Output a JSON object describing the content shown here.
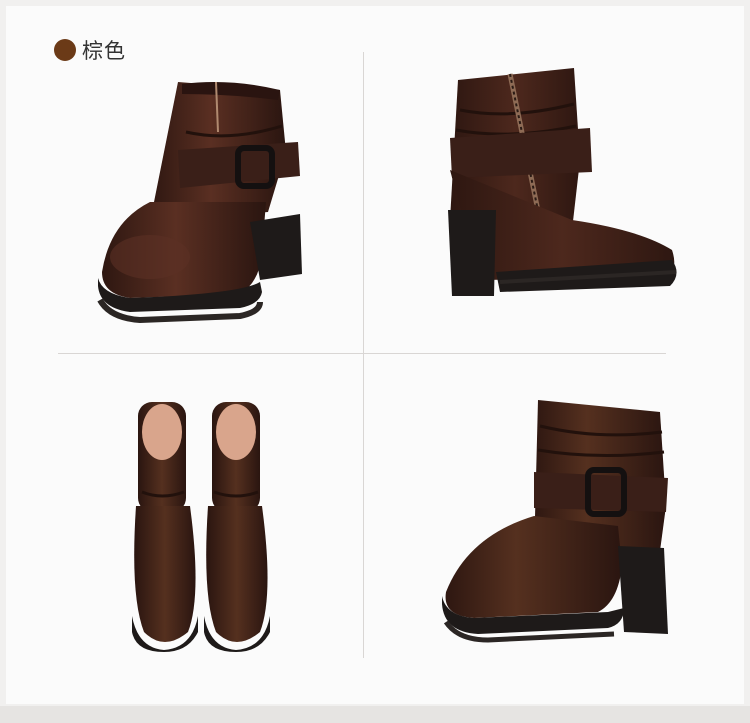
{
  "color_option": {
    "label": "棕色",
    "swatch_color": "#6b3a17"
  },
  "product_views": [
    {
      "view": "front-three-quarter",
      "icon": "brown-ankle-boot-buckle"
    },
    {
      "view": "inner-side-zipper",
      "icon": "brown-ankle-boot-zipper"
    },
    {
      "view": "top-pair",
      "icon": "brown-ankle-boot-pair"
    },
    {
      "view": "outer-side",
      "icon": "brown-ankle-boot-side"
    }
  ],
  "colors": {
    "leather": "#3d1f16",
    "leather_highlight": "#5a2f22",
    "sole": "#1e1a19",
    "lining": "#d9a58c",
    "background": "#fbfbfb"
  }
}
